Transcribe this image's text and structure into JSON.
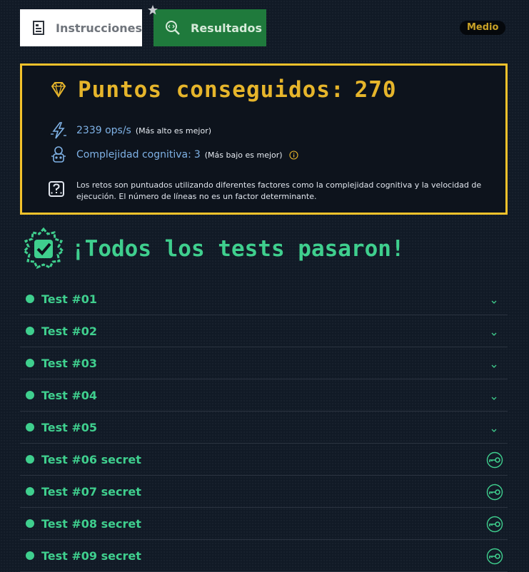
{
  "tabs": {
    "instructions": {
      "label": "Instrucciones",
      "icon": "document-icon"
    },
    "results": {
      "label": "Resultados",
      "icon": "code-search-icon",
      "active": true
    }
  },
  "difficulty": "Medio",
  "score": {
    "title": "Puntos conseguidos:",
    "points": "270",
    "ops": {
      "value": "2339 ops/s",
      "note": "(Más alto es mejor)"
    },
    "complexity": {
      "label": "Complejidad cognitiva:",
      "value": "3",
      "note": "(Más bajo es mejor)"
    },
    "footnote": "Los retos son puntuados utilizando diferentes factores como la complejidad cognitiva y la velocidad de ejecución. El número de líneas no es un factor determinante."
  },
  "result_banner": "¡Todos los tests pasaron!",
  "tests": [
    {
      "label": "Test #01",
      "secret": false
    },
    {
      "label": "Test #02",
      "secret": false
    },
    {
      "label": "Test #03",
      "secret": false
    },
    {
      "label": "Test #04",
      "secret": false
    },
    {
      "label": "Test #05",
      "secret": false
    },
    {
      "label": "Test #06 secret",
      "secret": true
    },
    {
      "label": "Test #07 secret",
      "secret": true
    },
    {
      "label": "Test #08 secret",
      "secret": true
    },
    {
      "label": "Test #09 secret",
      "secret": true
    }
  ],
  "colors": {
    "accent_green": "#3fcf8e",
    "gold": "#e6b52b",
    "panel_border": "#f3c22b",
    "tab_green": "#1f7a3c"
  }
}
